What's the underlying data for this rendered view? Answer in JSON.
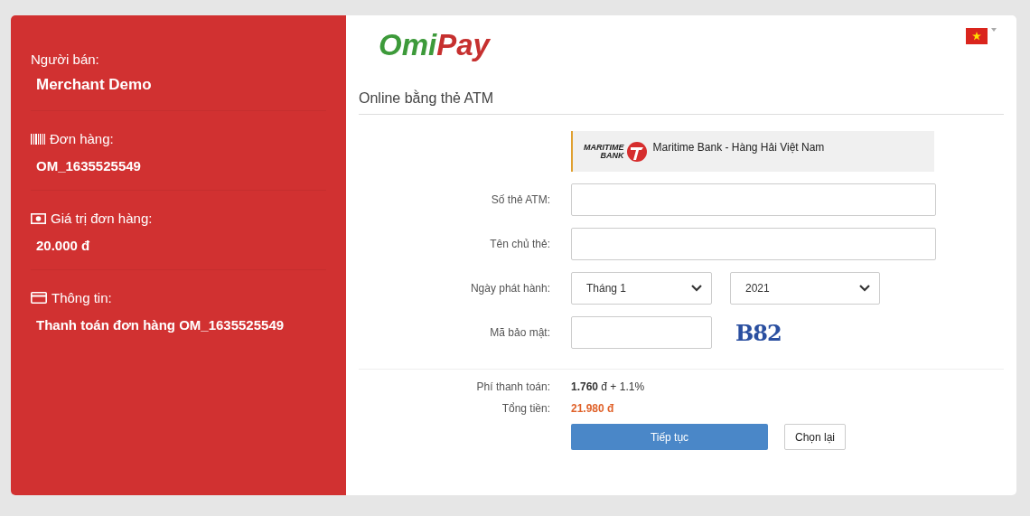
{
  "sidebar": {
    "items": [
      {
        "kind": "seller",
        "label": "Người bán:",
        "value": "Merchant Demo"
      },
      {
        "kind": "order",
        "label": "Đơn hàng:",
        "value": "OM_1635525549"
      },
      {
        "kind": "amount",
        "label": "Giá trị đơn hàng:",
        "value": "20.000 đ"
      },
      {
        "kind": "info",
        "label": "Thông tin:",
        "value": "Thanh toán đơn hàng OM_1635525549"
      }
    ]
  },
  "header": {
    "logo": {
      "part_1": "Omi",
      "part_2": "Pay"
    }
  },
  "section_title": "Online bằng thẻ ATM",
  "bank": {
    "logo_line_1": "MARITIME",
    "logo_line_2": "BANK",
    "name": "Maritime Bank - Hàng Hải Việt Nam"
  },
  "fields": [
    {
      "kind": "input",
      "label": "Số thẻ ATM:"
    },
    {
      "kind": "input",
      "label": "Tên chủ thẻ:"
    },
    {
      "kind": "selects",
      "label": "Ngày phát hành:",
      "month": "Tháng 1",
      "year": "2021"
    },
    {
      "kind": "captcha",
      "label": "Mã bảo mật:",
      "code": "B82"
    }
  ],
  "summary": [
    {
      "kind": "fee",
      "label": "Phí thanh toán:",
      "value": "**1.760** đ + 1.1%"
    },
    {
      "kind": "total",
      "label": "Tổng tiền:",
      "value": "21.980 đ"
    }
  ],
  "buttons": {
    "primary": "Tiếp tục",
    "secondary": "Chọn lại"
  }
}
